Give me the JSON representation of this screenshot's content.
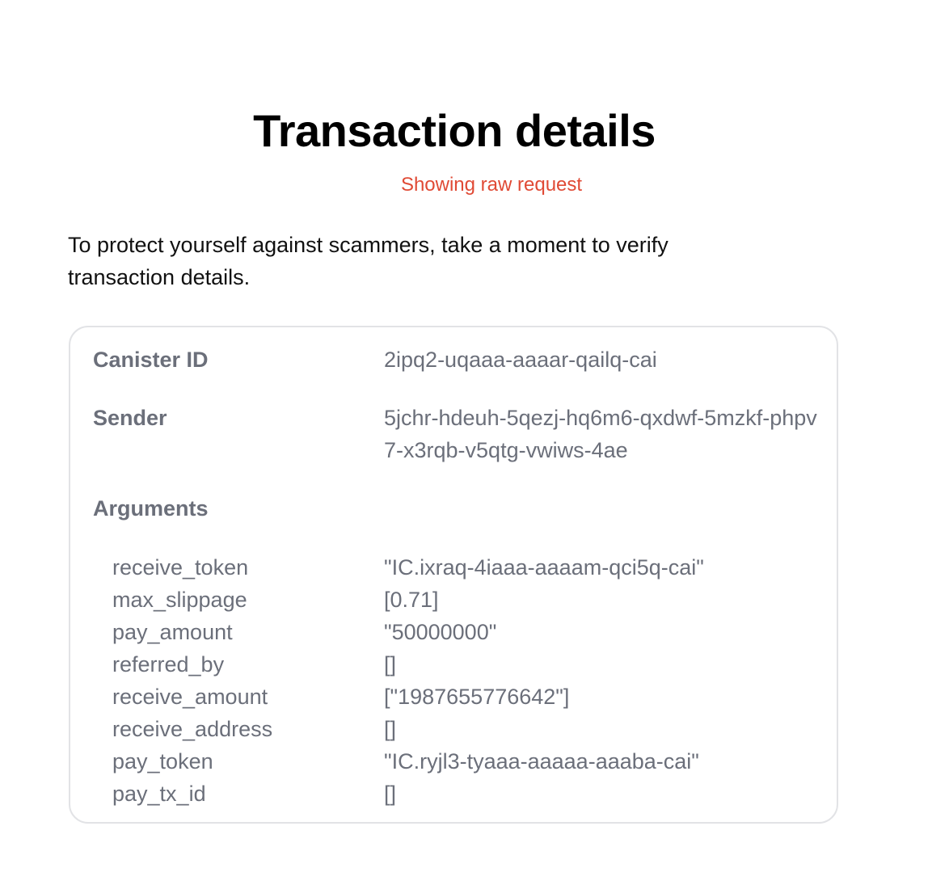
{
  "header": {
    "title": "Transaction details",
    "raw_badge": "Showing raw request"
  },
  "intro": {
    "text": "To protect yourself against scammers, take a moment to verify transaction details."
  },
  "details": {
    "canister_id": {
      "label": "Canister ID",
      "value": "2ipq2-uqaaa-aaaar-qailq-cai"
    },
    "sender": {
      "label": "Sender",
      "value": "5jchr-hdeuh-5qezj-hq6m6-qxdwf-5mzkf-phpv7-x3rqb-v5qtg-vwiws-4ae"
    },
    "arguments": {
      "label": "Arguments",
      "items": [
        {
          "name": "receive_token",
          "value": "\"IC.ixraq-4iaaa-aaaam-qci5q-cai\""
        },
        {
          "name": "max_slippage",
          "value": "[0.71]"
        },
        {
          "name": "pay_amount",
          "value": "\"50000000\""
        },
        {
          "name": "referred_by",
          "value": "[]"
        },
        {
          "name": "receive_amount",
          "value": "[\"1987655776642\"]"
        },
        {
          "name": "receive_address",
          "value": "[]"
        },
        {
          "name": "pay_token",
          "value": "\"IC.ryjl3-tyaaa-aaaaa-aaaba-cai\""
        },
        {
          "name": "pay_tx_id",
          "value": "[]"
        }
      ]
    }
  },
  "colors": {
    "accent_warning": "#e04a35",
    "muted_text": "#6b6f7a",
    "card_border": "#e2e3e6"
  }
}
